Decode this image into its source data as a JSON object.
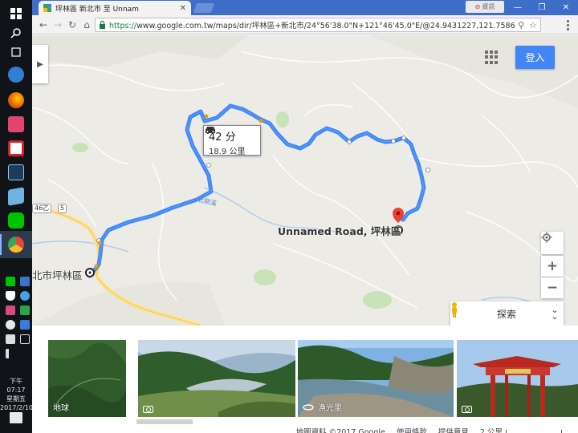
{
  "taskbar": {
    "apps": [
      {
        "icon": "windows-logo-icon",
        "color": "#ffffff"
      },
      {
        "icon": "search-icon",
        "color": "#ffffff"
      },
      {
        "icon": "task-view-icon",
        "color": "#ffffff"
      },
      {
        "icon": "edge-icon",
        "color": "#2f7fd6"
      },
      {
        "icon": "firefox-icon",
        "color": "#e66000"
      },
      {
        "icon": "app-pink-icon",
        "color": "#e0446f"
      },
      {
        "icon": "app-red-icon",
        "color": "#d81e2a"
      },
      {
        "icon": "lightroom-icon",
        "color": "#1f3a5a"
      },
      {
        "icon": "app-book-icon",
        "color": "#6fb3e0"
      },
      {
        "icon": "line-icon",
        "color": "#00c300"
      },
      {
        "icon": "chrome-icon",
        "color": "#e8453c"
      }
    ],
    "clock": {
      "time": "下午 07:17",
      "day": "星期五",
      "date": "2017/2/10"
    }
  },
  "browser": {
    "tab_title": "坪林區 新北市 至 Unnam",
    "profile_label": "資訊",
    "url_scheme": "https://",
    "url_rest": "www.google.com.tw/maps/dir/坪林區+新北市/24°56'38.0\"N+121°46'45.0\"E/@24.9431227,121.7586681,13z/data=",
    "url": "https://www.google.com.tw/maps/dir/坪林區+新北市/24°56'38.0\"N+121°46'45.0\"E/@24.9431227,121.7586681,13z/data="
  },
  "map": {
    "login_label": "登入",
    "route": {
      "time": "42 分",
      "distance": "18.9 公里"
    },
    "destination_label": "Unnamed Road, 坪林區",
    "origin_label": "北市坪林區",
    "river_label": "北勢溪",
    "road_badges": [
      "5",
      "46乙"
    ],
    "zoom_in": "+",
    "zoom_out": "−",
    "explore_label": "探索",
    "accent_color": "#4285f4",
    "route_color": "#4285f4"
  },
  "photos": [
    {
      "caption": "地球",
      "type": "satellite"
    },
    {
      "caption": "",
      "type": "photo"
    },
    {
      "caption": "漁光里",
      "type": "360"
    },
    {
      "caption": "",
      "type": "photo"
    }
  ],
  "footer": {
    "map_data": "地圖資料 ©2017 Google",
    "terms": "使用條款",
    "feedback": "提供意見",
    "scale": "2 公里"
  }
}
